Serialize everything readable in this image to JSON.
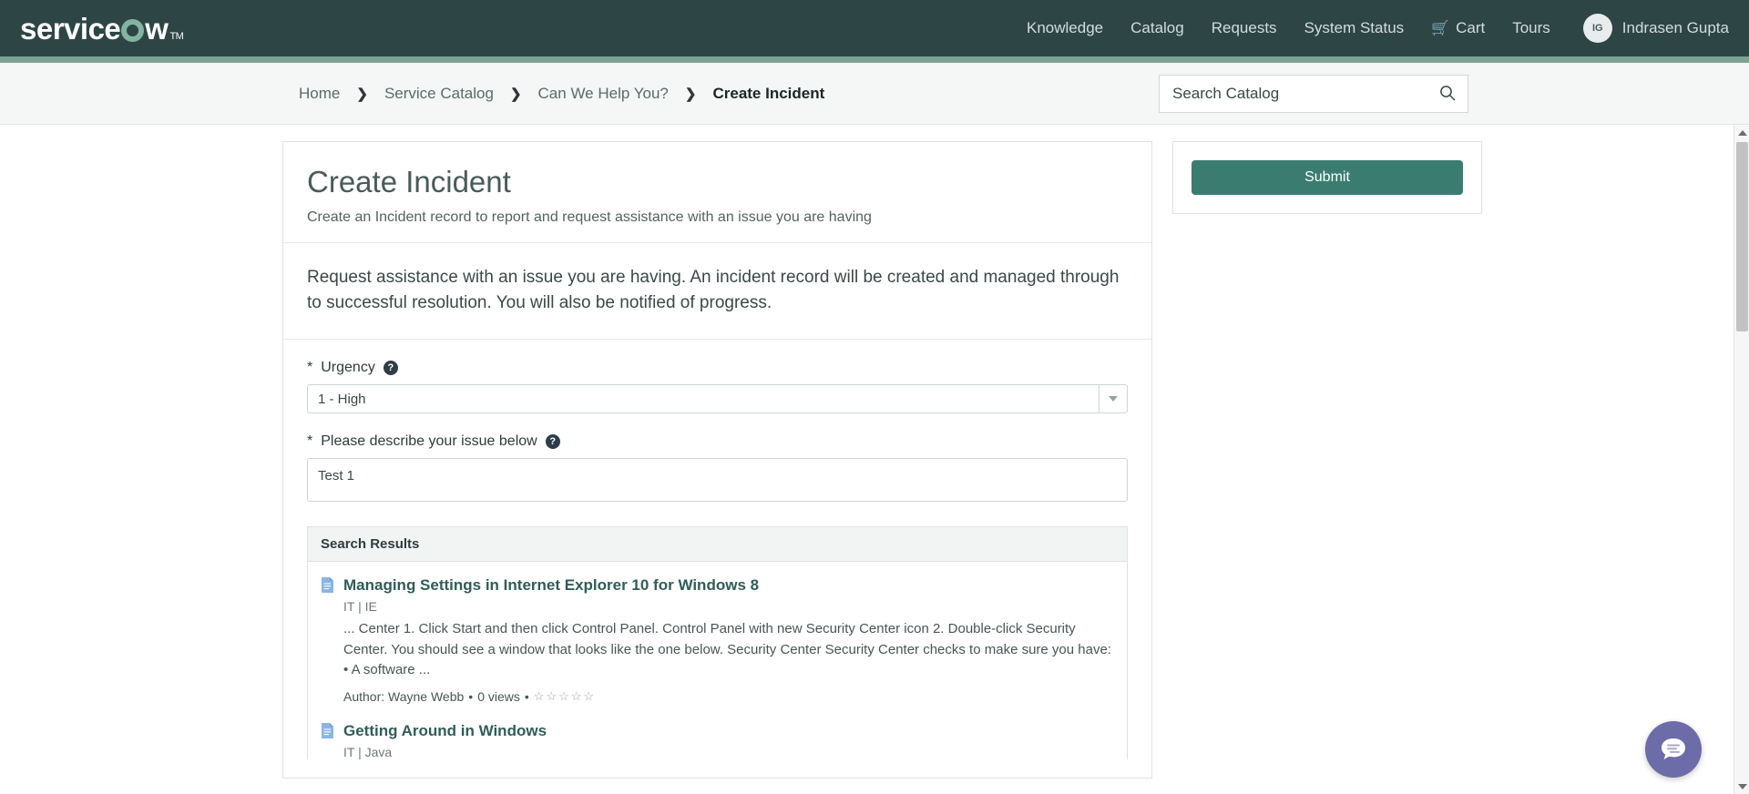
{
  "header": {
    "logo_text_before": "service",
    "logo_text_after": "w",
    "logo_tm": "TM",
    "nav": [
      {
        "label": "Knowledge",
        "name": "nav-knowledge"
      },
      {
        "label": "Catalog",
        "name": "nav-catalog"
      },
      {
        "label": "Requests",
        "name": "nav-requests"
      },
      {
        "label": "System Status",
        "name": "nav-system-status"
      }
    ],
    "cart_label": "Cart",
    "cart_icon": "cart-icon",
    "tours_label": "Tours",
    "user": {
      "initials": "IG",
      "name": "Indrasen Gupta"
    }
  },
  "breadcrumb": {
    "items": [
      {
        "label": "Home",
        "active": false
      },
      {
        "label": "Service Catalog",
        "active": false
      },
      {
        "label": "Can We Help You?",
        "active": false
      },
      {
        "label": "Create Incident",
        "active": true
      }
    ],
    "separator": "❯"
  },
  "search": {
    "placeholder": "Search Catalog",
    "value": "",
    "icon": "search-icon"
  },
  "form": {
    "title": "Create Incident",
    "subtitle": "Create an Incident record to report and request assistance with an issue you are having",
    "description": "Request assistance with an issue you are having. An incident record will be created and managed through to successful resolution. You will also be notified of progress.",
    "urgency": {
      "required_marker": "*",
      "label": "Urgency",
      "help_icon": "help-icon",
      "value": "1 - High"
    },
    "issue": {
      "required_marker": "*",
      "label": "Please describe your issue below",
      "help_icon": "help-icon",
      "value": "Test 1",
      "placeholder": ""
    }
  },
  "search_results": {
    "header": "Search Results",
    "items": [
      {
        "title": "Managing Settings in Internet Explorer 10 for Windows 8",
        "category": "IT | IE",
        "snippet": "... Center 1. Click Start and then click Control Panel. Control Panel with new Security Center icon 2. Double-click Security Center. You should see a window that looks like the one below. Security Center Security Center checks to make sure you have: • A software ...",
        "author_label": "Author: Wayne Webb",
        "views": "0 views",
        "separator": "•",
        "rating": 0,
        "rating_max": 5
      },
      {
        "title": "Getting Around in Windows",
        "category": "IT | Java",
        "snippet": "",
        "author_label": "",
        "views": "",
        "separator": "•",
        "rating": 0,
        "rating_max": 5
      }
    ]
  },
  "sidebar": {
    "submit_label": "Submit"
  },
  "chat": {
    "icon": "chat-bubble-icon",
    "label": "Chat"
  },
  "colors": {
    "header_bg": "#2e4545",
    "accent_stripe": "#7fa294",
    "logo_ring": "#81b5a1",
    "submit_bg": "#3a7d70",
    "link": "#2f5d58",
    "chat_bg": "#6c6ca8",
    "doc_icon": "#8ab4e8"
  }
}
